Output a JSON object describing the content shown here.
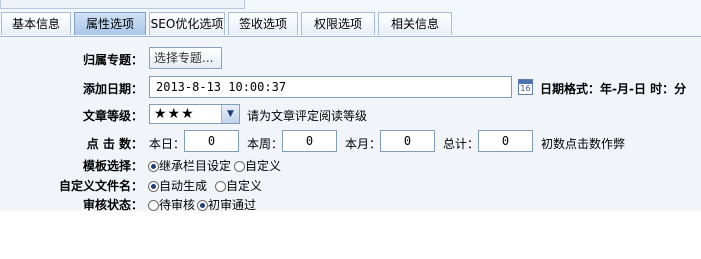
{
  "tabs": [
    {
      "label": "基本信息",
      "active": false
    },
    {
      "label": "属性选项",
      "active": true
    },
    {
      "label": "SEO优化选项",
      "active": false
    },
    {
      "label": "签收选项",
      "active": false
    },
    {
      "label": "权限选项",
      "active": false
    },
    {
      "label": "相关信息",
      "active": false
    }
  ],
  "topic": {
    "label": "归属专题：",
    "button": "选择专题..."
  },
  "date": {
    "label": "添加日期：",
    "value": "2013-8-13 10:00:37",
    "hint": "日期格式：年-月-日 时：分",
    "icon": "calendar-icon"
  },
  "grade": {
    "label": "文章等级：",
    "value": "★★★",
    "hint": "请为文章评定阅读等级"
  },
  "clicks": {
    "label": "点 击 数：",
    "day_label": "本日：",
    "day_value": "0",
    "week_label": "本周：",
    "week_value": "0",
    "month_label": "本月：",
    "month_value": "0",
    "total_label": "总计：",
    "total_value": "0",
    "hint": "初数点击数作弊"
  },
  "template": {
    "label": "模板选择：",
    "options": [
      "继承栏目设定",
      "自定义"
    ],
    "selected": 0
  },
  "filename": {
    "label": "自定义文件名：",
    "options": [
      "自动生成",
      "自定义"
    ],
    "selected": 0
  },
  "review": {
    "label": "审核状态：",
    "options": [
      "待审核",
      "初审通过"
    ],
    "selected": 1
  }
}
